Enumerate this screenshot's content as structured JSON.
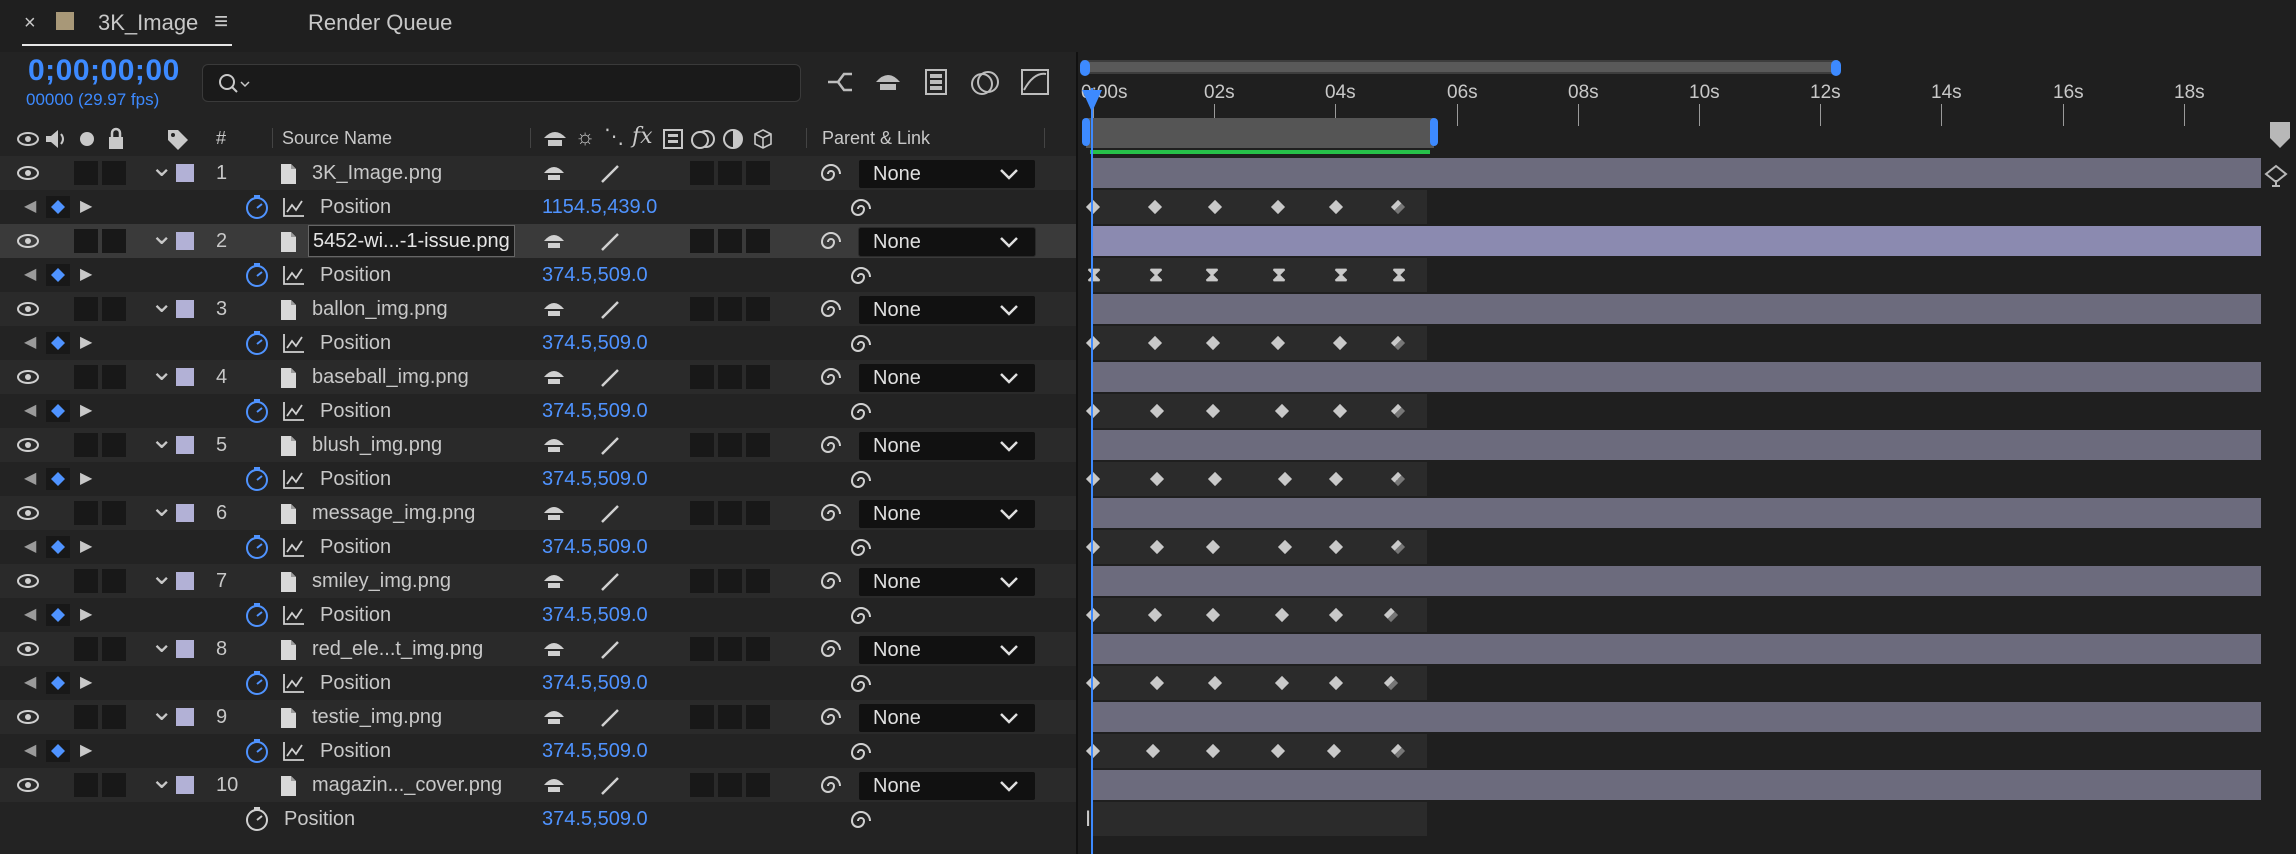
{
  "tabs": [
    {
      "label": "3K_Image",
      "active": true
    },
    {
      "label": "Render Queue",
      "active": false
    }
  ],
  "composition": {
    "timecode": "0;00;00;00",
    "frame_fps": "00000 (29.97 fps)"
  },
  "columns": {
    "number": "#",
    "source_name": "Source Name",
    "parent_link": "Parent & Link"
  },
  "layers": [
    {
      "num": "1",
      "name": "3K_Image.png",
      "parent": "None",
      "prop": "Position",
      "value": "1154.5,439.0"
    },
    {
      "num": "2",
      "name": "5452-wi...-1-issue.png",
      "parent": "None",
      "prop": "Position",
      "value": "374.5,509.0"
    },
    {
      "num": "3",
      "name": "ballon_img.png",
      "parent": "None",
      "prop": "Position",
      "value": "374.5,509.0"
    },
    {
      "num": "4",
      "name": "baseball_img.png",
      "parent": "None",
      "prop": "Position",
      "value": "374.5,509.0"
    },
    {
      "num": "5",
      "name": "blush_img.png",
      "parent": "None",
      "prop": "Position",
      "value": "374.5,509.0"
    },
    {
      "num": "6",
      "name": "message_img.png",
      "parent": "None",
      "prop": "Position",
      "value": "374.5,509.0"
    },
    {
      "num": "7",
      "name": "smiley_img.png",
      "parent": "None",
      "prop": "Position",
      "value": "374.5,509.0"
    },
    {
      "num": "8",
      "name": "red_ele...t_img.png",
      "parent": "None",
      "prop": "Position",
      "value": "374.5,509.0"
    },
    {
      "num": "9",
      "name": "testie_img.png",
      "parent": "None",
      "prop": "Position",
      "value": "374.5,509.0"
    },
    {
      "num": "10",
      "name": "magazin..._cover.png",
      "parent": "None",
      "prop": "Position",
      "value": "374.5,509.0"
    }
  ],
  "ruler": {
    "labels": [
      "0:00s",
      "02s",
      "04s",
      "06s",
      "08s",
      "10s",
      "12s",
      "14s",
      "16s",
      "18s"
    ]
  },
  "colors": {
    "accent_blue": "#3d8aff",
    "layer_label": "#b2b1d6",
    "layer_bar": "#6c6b7d",
    "work_area_green": "#27c04a"
  }
}
